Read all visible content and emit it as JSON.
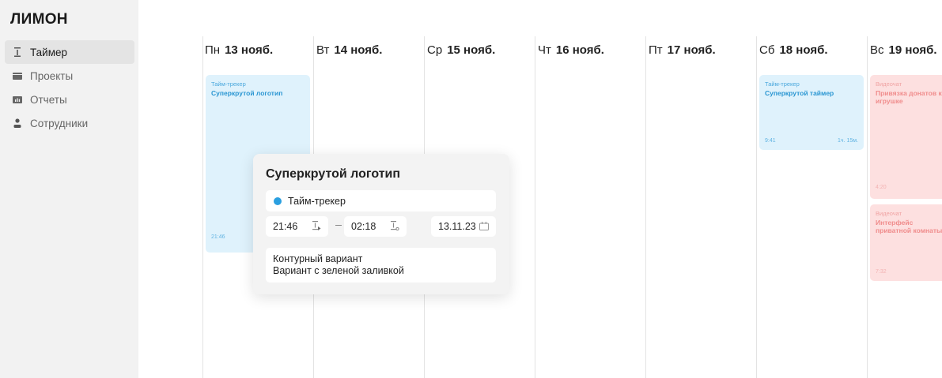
{
  "app": {
    "logo": "ЛИМОН"
  },
  "sidebar": {
    "items": [
      {
        "label": "Таймер",
        "icon": "timer-icon",
        "active": true
      },
      {
        "label": "Проекты",
        "icon": "folder-icon",
        "active": false
      },
      {
        "label": "Отчеты",
        "icon": "report-icon",
        "active": false
      },
      {
        "label": "Сотрудники",
        "icon": "person-icon",
        "active": false
      }
    ]
  },
  "days": [
    {
      "name": "Пн",
      "date": "13 нояб."
    },
    {
      "name": "Вт",
      "date": "14 нояб."
    },
    {
      "name": "Ср",
      "date": "15 нояб."
    },
    {
      "name": "Чт",
      "date": "16 нояб."
    },
    {
      "name": "Пт",
      "date": "17 нояб."
    },
    {
      "name": "Сб",
      "date": "18 нояб."
    },
    {
      "name": "Вс",
      "date": "19 нояб."
    }
  ],
  "events": [
    {
      "project": "Тайм-трекер",
      "title": "Суперкрутой логотип",
      "time": "21:46",
      "duration": ""
    },
    {
      "project": "Тайм-трекер",
      "title": "Суперкрутой таймер",
      "time": "9:41",
      "duration": "1ч. 15м."
    },
    {
      "project": "Видеочат",
      "title": "Привязка донатов к игрушке",
      "time": "4:20",
      "duration": ""
    },
    {
      "project": "Видеочат",
      "title": "Интерфейс приватной комнаты",
      "time": "7:32",
      "duration": ""
    }
  ],
  "popover": {
    "title": "Суперкрутой логотип",
    "project": "Тайм-трекер",
    "start_time": "21:46",
    "end_time": "02:18",
    "date": "13.11.23",
    "note_line1": "Контурный вариант",
    "note_line2": "Вариант с зеленой заливкой"
  },
  "colors": {
    "accent_blue": "#2a9fe0",
    "event_blue_bg": "#dff2fc",
    "event_pink_bg": "#fde0e0",
    "sidebar_bg": "#f2f2f2"
  }
}
